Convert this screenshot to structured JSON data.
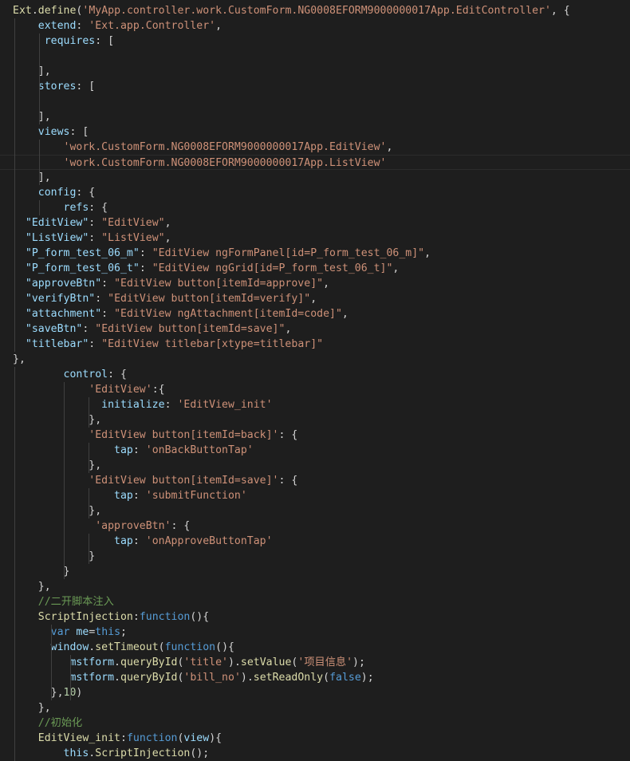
{
  "editor": {
    "lines": [
      [
        [
          "f",
          "Ext"
        ],
        [
          "d",
          "."
        ],
        [
          "f",
          "define"
        ],
        [
          "d",
          "("
        ],
        [
          "s",
          "'MyApp.controller.work.CustomForm.NG0008EFORM9000000017App.EditController'"
        ],
        [
          "d",
          ", {"
        ]
      ],
      [
        [
          "d",
          "    "
        ],
        [
          "p",
          "extend"
        ],
        [
          "d",
          ": "
        ],
        [
          "s",
          "'Ext.app.Controller'"
        ],
        [
          "d",
          ","
        ]
      ],
      [
        [
          "d",
          "     "
        ],
        [
          "p",
          "requires"
        ],
        [
          "d",
          ": ["
        ]
      ],
      [],
      [
        [
          "d",
          "    ],"
        ]
      ],
      [
        [
          "d",
          "    "
        ],
        [
          "p",
          "stores"
        ],
        [
          "d",
          ": ["
        ]
      ],
      [],
      [
        [
          "d",
          "    ],"
        ]
      ],
      [
        [
          "d",
          "    "
        ],
        [
          "p",
          "views"
        ],
        [
          "d",
          ": ["
        ]
      ],
      [
        [
          "d",
          "        "
        ],
        [
          "s",
          "'work.CustomForm.NG0008EFORM9000000017App.EditView'"
        ],
        [
          "d",
          ","
        ]
      ],
      [
        [
          "d",
          "        "
        ],
        [
          "s",
          "'work.CustomForm.NG0008EFORM9000000017App.ListView'"
        ]
      ],
      [
        [
          "d",
          "    ],"
        ]
      ],
      [
        [
          "d",
          "    "
        ],
        [
          "p",
          "config"
        ],
        [
          "d",
          ": {"
        ]
      ],
      [
        [
          "d",
          "        "
        ],
        [
          "p",
          "refs"
        ],
        [
          "d",
          ": {"
        ]
      ],
      [
        [
          "d",
          "  "
        ],
        [
          "p",
          "\"EditView\""
        ],
        [
          "d",
          ": "
        ],
        [
          "s",
          "\"EditView\""
        ],
        [
          "d",
          ","
        ]
      ],
      [
        [
          "d",
          "  "
        ],
        [
          "p",
          "\"ListView\""
        ],
        [
          "d",
          ": "
        ],
        [
          "s",
          "\"ListView\""
        ],
        [
          "d",
          ","
        ]
      ],
      [
        [
          "d",
          "  "
        ],
        [
          "p",
          "\"P_form_test_06_m\""
        ],
        [
          "d",
          ": "
        ],
        [
          "s",
          "\"EditView ngFormPanel[id=P_form_test_06_m]\""
        ],
        [
          "d",
          ","
        ]
      ],
      [
        [
          "d",
          "  "
        ],
        [
          "p",
          "\"P_form_test_06_t\""
        ],
        [
          "d",
          ": "
        ],
        [
          "s",
          "\"EditView ngGrid[id=P_form_test_06_t]\""
        ],
        [
          "d",
          ","
        ]
      ],
      [
        [
          "d",
          "  "
        ],
        [
          "p",
          "\"approveBtn\""
        ],
        [
          "d",
          ": "
        ],
        [
          "s",
          "\"EditView button[itemId=approve]\""
        ],
        [
          "d",
          ","
        ]
      ],
      [
        [
          "d",
          "  "
        ],
        [
          "p",
          "\"verifyBtn\""
        ],
        [
          "d",
          ": "
        ],
        [
          "s",
          "\"EditView button[itemId=verify]\""
        ],
        [
          "d",
          ","
        ]
      ],
      [
        [
          "d",
          "  "
        ],
        [
          "p",
          "\"attachment\""
        ],
        [
          "d",
          ": "
        ],
        [
          "s",
          "\"EditView ngAttachment[itemId=code]\""
        ],
        [
          "d",
          ","
        ]
      ],
      [
        [
          "d",
          "  "
        ],
        [
          "p",
          "\"saveBtn\""
        ],
        [
          "d",
          ": "
        ],
        [
          "s",
          "\"EditView button[itemId=save]\""
        ],
        [
          "d",
          ","
        ]
      ],
      [
        [
          "d",
          "  "
        ],
        [
          "p",
          "\"titlebar\""
        ],
        [
          "d",
          ": "
        ],
        [
          "s",
          "\"EditView titlebar[xtype=titlebar]\""
        ]
      ],
      [
        [
          "d",
          "},"
        ]
      ],
      [
        [
          "d",
          "        "
        ],
        [
          "p",
          "control"
        ],
        [
          "d",
          ": {"
        ]
      ],
      [
        [
          "d",
          "            "
        ],
        [
          "s",
          "'EditView'"
        ],
        [
          "d",
          ":{"
        ]
      ],
      [
        [
          "d",
          "              "
        ],
        [
          "p",
          "initialize"
        ],
        [
          "d",
          ": "
        ],
        [
          "s",
          "'EditView_init'"
        ]
      ],
      [
        [
          "d",
          "            },"
        ]
      ],
      [
        [
          "d",
          "            "
        ],
        [
          "s",
          "'EditView button[itemId=back]'"
        ],
        [
          "d",
          ": {"
        ]
      ],
      [
        [
          "d",
          "                "
        ],
        [
          "p",
          "tap"
        ],
        [
          "d",
          ": "
        ],
        [
          "s",
          "'onBackButtonTap'"
        ]
      ],
      [
        [
          "d",
          "            },"
        ]
      ],
      [
        [
          "d",
          "            "
        ],
        [
          "s",
          "'EditView button[itemId=save]'"
        ],
        [
          "d",
          ": {"
        ]
      ],
      [
        [
          "d",
          "                "
        ],
        [
          "p",
          "tap"
        ],
        [
          "d",
          ": "
        ],
        [
          "s",
          "'submitFunction'"
        ]
      ],
      [
        [
          "d",
          "            },"
        ]
      ],
      [
        [
          "d",
          "             "
        ],
        [
          "s",
          "'approveBtn'"
        ],
        [
          "d",
          ": {"
        ]
      ],
      [
        [
          "d",
          "                "
        ],
        [
          "p",
          "tap"
        ],
        [
          "d",
          ": "
        ],
        [
          "s",
          "'onApproveButtonTap'"
        ]
      ],
      [
        [
          "d",
          "            }"
        ]
      ],
      [
        [
          "d",
          "        }"
        ]
      ],
      [
        [
          "d",
          "    },"
        ]
      ],
      [
        [
          "d",
          "    "
        ],
        [
          "c",
          "//二开脚本注入"
        ]
      ],
      [
        [
          "d",
          "    "
        ],
        [
          "f",
          "ScriptInjection"
        ],
        [
          "d",
          ":"
        ],
        [
          "k",
          "function"
        ],
        [
          "d",
          "(){"
        ]
      ],
      [
        [
          "d",
          "      "
        ],
        [
          "k",
          "var"
        ],
        [
          "d",
          " "
        ],
        [
          "p",
          "me"
        ],
        [
          "d",
          "="
        ],
        [
          "k",
          "this"
        ],
        [
          "d",
          ";"
        ]
      ],
      [
        [
          "d",
          "      "
        ],
        [
          "p",
          "window"
        ],
        [
          "d",
          "."
        ],
        [
          "f",
          "setTimeout"
        ],
        [
          "d",
          "("
        ],
        [
          "k",
          "function"
        ],
        [
          "d",
          "(){"
        ]
      ],
      [
        [
          "d",
          "         "
        ],
        [
          "p",
          "mstform"
        ],
        [
          "d",
          "."
        ],
        [
          "f",
          "queryById"
        ],
        [
          "d",
          "("
        ],
        [
          "s",
          "'title'"
        ],
        [
          "d",
          ")."
        ],
        [
          "f",
          "setValue"
        ],
        [
          "d",
          "("
        ],
        [
          "s",
          "'项目信息'"
        ],
        [
          "d",
          ");"
        ]
      ],
      [
        [
          "d",
          "         "
        ],
        [
          "p",
          "mstform"
        ],
        [
          "d",
          "."
        ],
        [
          "f",
          "queryById"
        ],
        [
          "d",
          "("
        ],
        [
          "s",
          "'bill_no'"
        ],
        [
          "d",
          ")."
        ],
        [
          "f",
          "setReadOnly"
        ],
        [
          "d",
          "("
        ],
        [
          "k",
          "false"
        ],
        [
          "d",
          ");"
        ]
      ],
      [
        [
          "d",
          "      },"
        ],
        [
          "n",
          "10"
        ],
        [
          "d",
          ")"
        ]
      ],
      [
        [
          "d",
          "    },"
        ]
      ],
      [
        [
          "d",
          "    "
        ],
        [
          "c",
          "//初始化"
        ]
      ],
      [
        [
          "d",
          "    "
        ],
        [
          "f",
          "EditView_init"
        ],
        [
          "d",
          ":"
        ],
        [
          "k",
          "function"
        ],
        [
          "d",
          "("
        ],
        [
          "p",
          "view"
        ],
        [
          "d",
          "){"
        ]
      ],
      [
        [
          "d",
          "        "
        ],
        [
          "p",
          "this"
        ],
        [
          "d",
          "."
        ],
        [
          "f",
          "ScriptInjection"
        ],
        [
          "d",
          "();"
        ]
      ]
    ]
  }
}
